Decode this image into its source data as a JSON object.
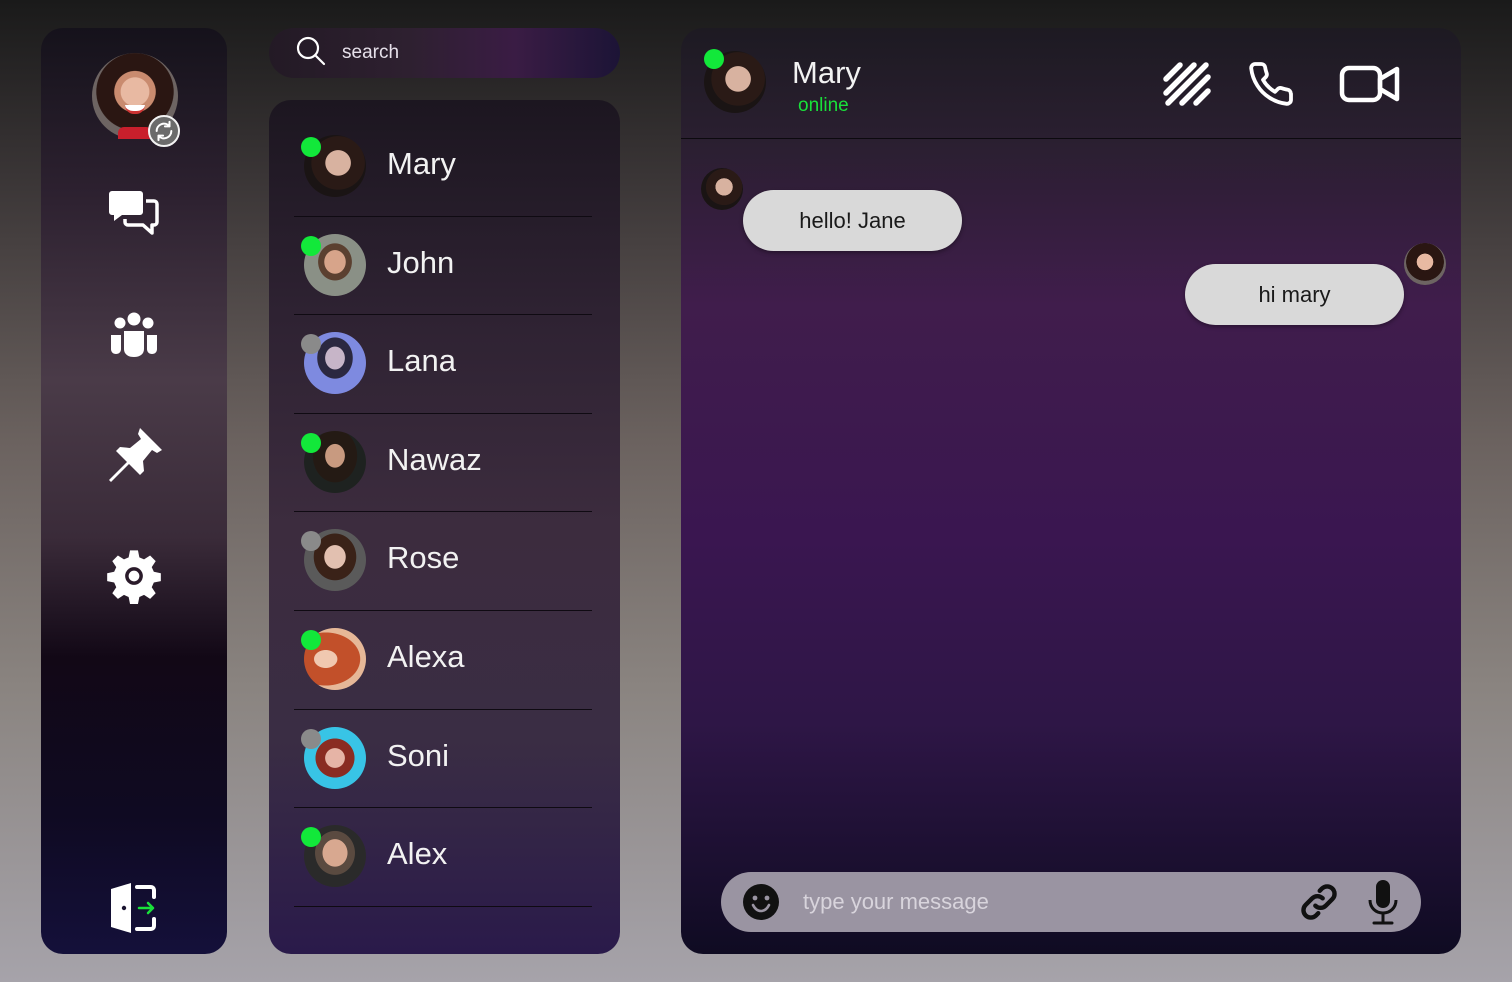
{
  "colors": {
    "online": "#12e83a",
    "offline": "#8a8a8a",
    "status_text": "#19e03a",
    "bubble": "#d9d9d9"
  },
  "sidebar": {
    "items": [
      {
        "icon": "chat-bubbles-icon"
      },
      {
        "icon": "group-icon"
      },
      {
        "icon": "pin-icon"
      },
      {
        "icon": "gear-icon"
      },
      {
        "icon": "logout-icon"
      }
    ]
  },
  "search": {
    "placeholder": "search"
  },
  "contacts": [
    {
      "name": "Mary",
      "status": "online"
    },
    {
      "name": "John",
      "status": "online"
    },
    {
      "name": "Lana",
      "status": "offline"
    },
    {
      "name": "Nawaz",
      "status": "online"
    },
    {
      "name": "Rose",
      "status": "offline"
    },
    {
      "name": "Alexa",
      "status": "online"
    },
    {
      "name": "Soni",
      "status": "offline"
    },
    {
      "name": "Alex",
      "status": "online"
    }
  ],
  "chat": {
    "contact_name": "Mary",
    "contact_status": "online",
    "header_icons": [
      "slash-pattern-icon",
      "phone-icon",
      "video-camera-icon"
    ],
    "messages": [
      {
        "from": "Mary",
        "text": "hello! Jane",
        "side": "left"
      },
      {
        "from": "me",
        "text": "hi mary",
        "side": "right"
      }
    ],
    "composer": {
      "placeholder": "type your message"
    }
  }
}
